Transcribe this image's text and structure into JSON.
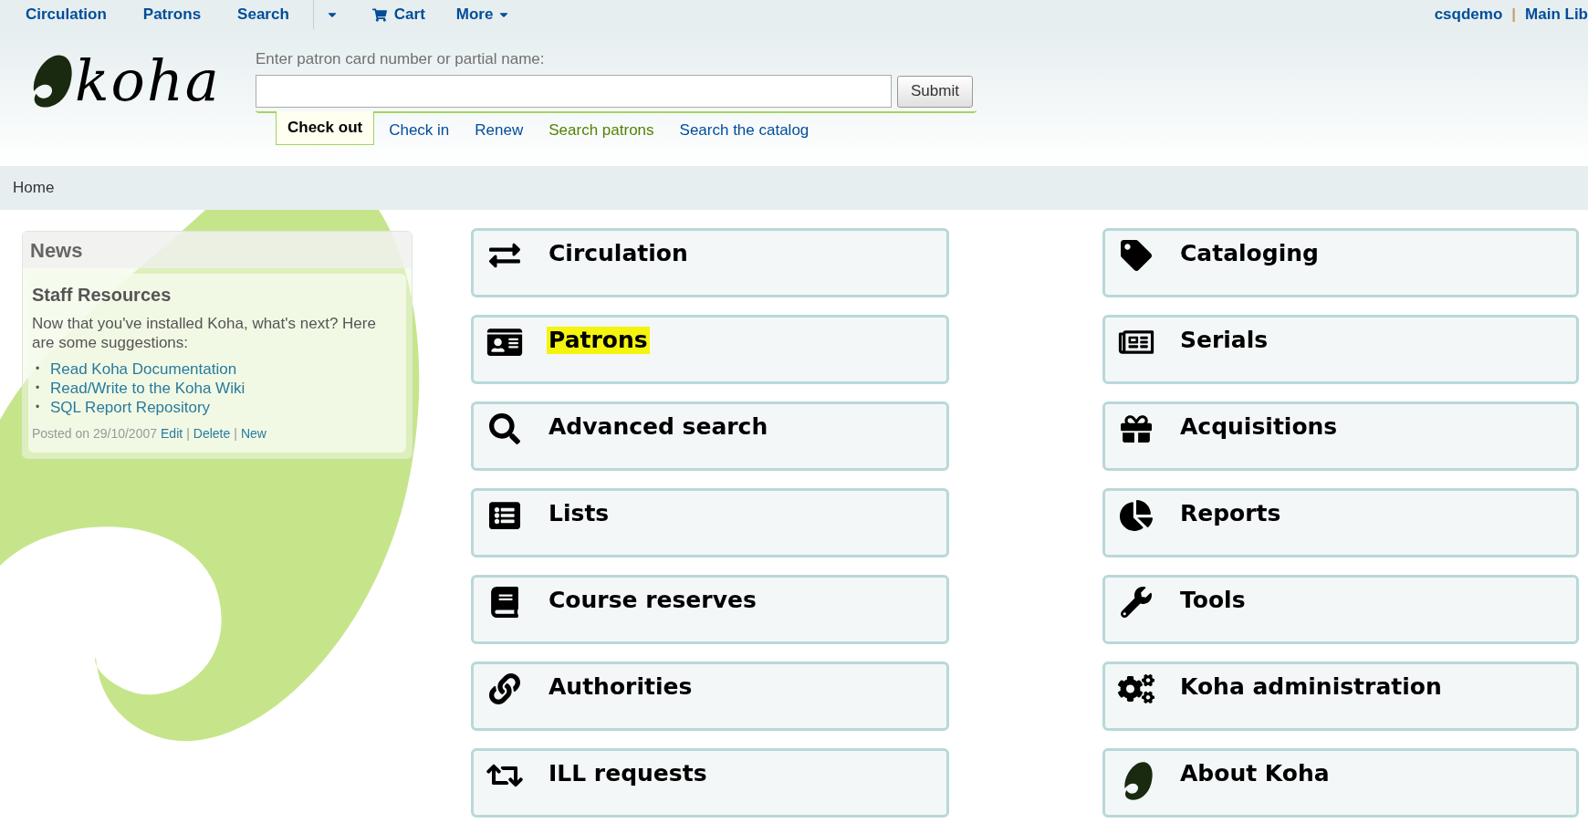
{
  "topnav": {
    "items": [
      {
        "label": "Circulation",
        "kind": "link"
      },
      {
        "label": "Patrons",
        "kind": "link"
      },
      {
        "label": "Search",
        "kind": "link"
      },
      {
        "kind": "caret"
      },
      {
        "label": "Cart",
        "kind": "cart"
      },
      {
        "label": "More",
        "kind": "menu"
      }
    ],
    "user": "csqdemo",
    "separator": "|",
    "library": "Main Lib"
  },
  "logo": {
    "text": "koha"
  },
  "patron_search": {
    "label": "Enter patron card number or partial name:",
    "submit": "Submit"
  },
  "search_tabs": [
    {
      "label": "Check out",
      "selected": true,
      "visited": false
    },
    {
      "label": "Check in",
      "selected": false,
      "visited": false
    },
    {
      "label": "Renew",
      "selected": false,
      "visited": false
    },
    {
      "label": "Search patrons",
      "selected": false,
      "visited": true
    },
    {
      "label": "Search the catalog",
      "selected": false,
      "visited": false
    }
  ],
  "breadcrumb": "Home",
  "news": {
    "title": "News",
    "heading": "Staff Resources",
    "body": "Now that you've installed Koha, what's next? Here are some suggestions:",
    "bullet": "•",
    "links": [
      "Read Koha Documentation",
      "Read/Write to the Koha Wiki",
      "SQL Report Repository"
    ],
    "posted": "Posted on 29/10/2007",
    "actions": [
      "Edit",
      "Delete",
      "New"
    ],
    "action_separator": "|"
  },
  "modules_left": [
    {
      "label": "Circulation",
      "kind": "exchange",
      "highlighted": false
    },
    {
      "label": "Patrons",
      "kind": "idcard",
      "highlighted": true
    },
    {
      "label": "Advanced search",
      "kind": "search",
      "highlighted": false
    },
    {
      "label": "Lists",
      "kind": "list",
      "highlighted": false
    },
    {
      "label": "Course reserves",
      "kind": "book",
      "highlighted": false
    },
    {
      "label": "Authorities",
      "kind": "link",
      "highlighted": false
    },
    {
      "label": "ILL requests",
      "kind": "retweet",
      "highlighted": false
    }
  ],
  "modules_right": [
    {
      "label": "Cataloging",
      "kind": "tag",
      "highlighted": false
    },
    {
      "label": "Serials",
      "kind": "newspaper",
      "highlighted": false
    },
    {
      "label": "Acquisitions",
      "kind": "gift",
      "highlighted": false
    },
    {
      "label": "Reports",
      "kind": "pie",
      "highlighted": false
    },
    {
      "label": "Tools",
      "kind": "wrench",
      "highlighted": false
    },
    {
      "label": "Koha administration",
      "kind": "cogs",
      "highlighted": false
    },
    {
      "label": "About Koha",
      "kind": "leaf",
      "highlighted": false
    }
  ]
}
